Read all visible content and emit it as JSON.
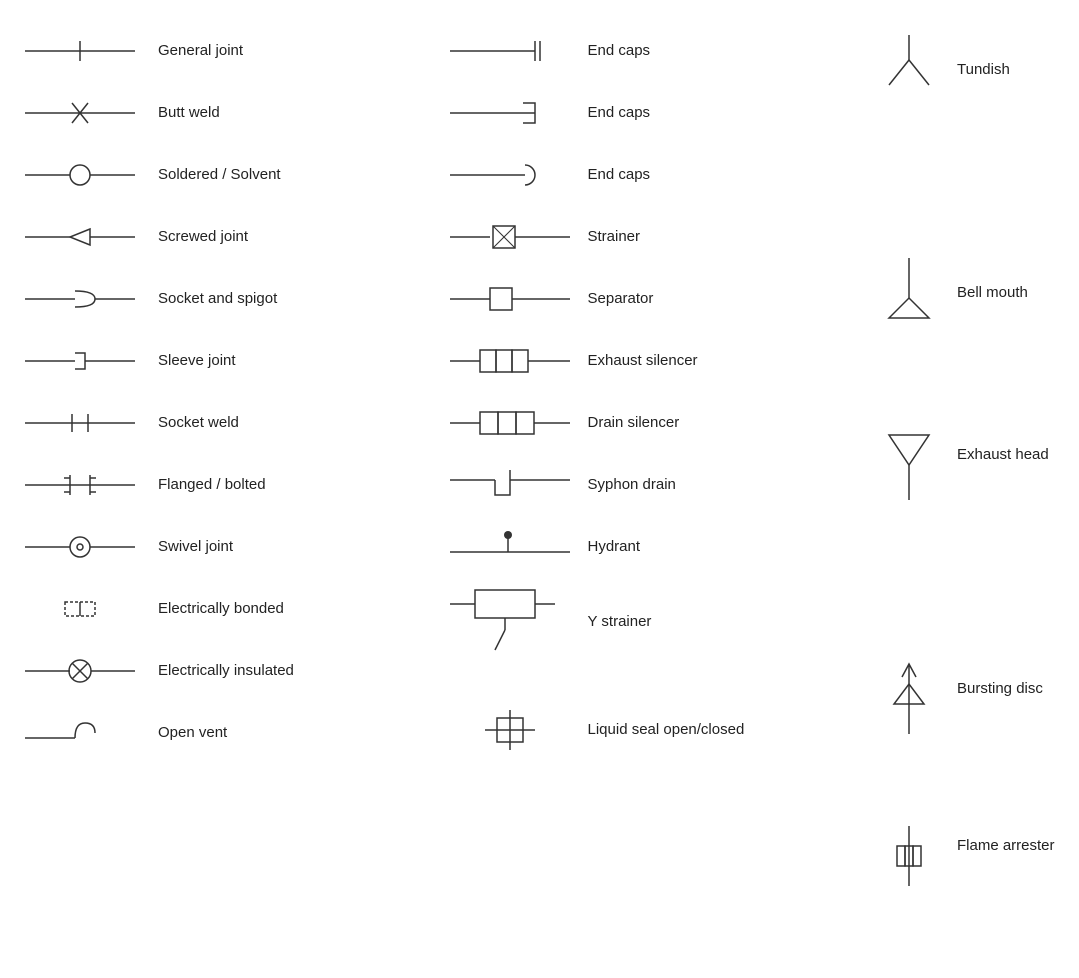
{
  "col1": [
    {
      "label": "General joint",
      "symbol": "general_joint"
    },
    {
      "label": "Butt weld",
      "symbol": "butt_weld"
    },
    {
      "label": "Soldered / Solvent",
      "symbol": "soldered"
    },
    {
      "label": "Screwed joint",
      "symbol": "screwed_joint"
    },
    {
      "label": "Socket and spigot",
      "symbol": "socket_spigot"
    },
    {
      "label": "Sleeve joint",
      "symbol": "sleeve_joint"
    },
    {
      "label": "Socket weld",
      "symbol": "socket_weld"
    },
    {
      "label": "Flanged / bolted",
      "symbol": "flanged_bolted"
    },
    {
      "label": "Swivel joint",
      "symbol": "swivel_joint"
    },
    {
      "label": "Electrically bonded",
      "symbol": "elec_bonded"
    },
    {
      "label": "Electrically insulated",
      "symbol": "elec_insulated"
    },
    {
      "label": "Open vent",
      "symbol": "open_vent"
    }
  ],
  "col2": [
    {
      "label": "End caps",
      "symbol": "end_cap1"
    },
    {
      "label": "End caps",
      "symbol": "end_cap2"
    },
    {
      "label": "End caps",
      "symbol": "end_cap3"
    },
    {
      "label": "Strainer",
      "symbol": "strainer"
    },
    {
      "label": "Separator",
      "symbol": "separator"
    },
    {
      "label": "Exhaust silencer",
      "symbol": "exhaust_silencer"
    },
    {
      "label": "Drain silencer",
      "symbol": "drain_silencer"
    },
    {
      "label": "Syphon drain",
      "symbol": "syphon_drain"
    },
    {
      "label": "Hydrant",
      "symbol": "hydrant"
    },
    {
      "label": "Y strainer",
      "symbol": "y_strainer"
    },
    {
      "label": "",
      "symbol": "blank"
    },
    {
      "label": "Liquid seal open/closed",
      "symbol": "liquid_seal"
    }
  ],
  "col3": [
    {
      "label": "Tundish",
      "symbol": "tundish"
    },
    {
      "label": "",
      "symbol": "blank"
    },
    {
      "label": "",
      "symbol": "blank"
    },
    {
      "label": "Bell mouth",
      "symbol": "bell_mouth"
    },
    {
      "label": "",
      "symbol": "blank"
    },
    {
      "label": "Exhaust head",
      "symbol": "exhaust_head"
    },
    {
      "label": "",
      "symbol": "blank"
    },
    {
      "label": "",
      "symbol": "blank"
    },
    {
      "label": "Bursting disc",
      "symbol": "bursting_disc"
    },
    {
      "label": "",
      "symbol": "blank"
    },
    {
      "label": "Flame arrester",
      "symbol": "flame_arrester"
    },
    {
      "label": "",
      "symbol": "blank"
    }
  ]
}
